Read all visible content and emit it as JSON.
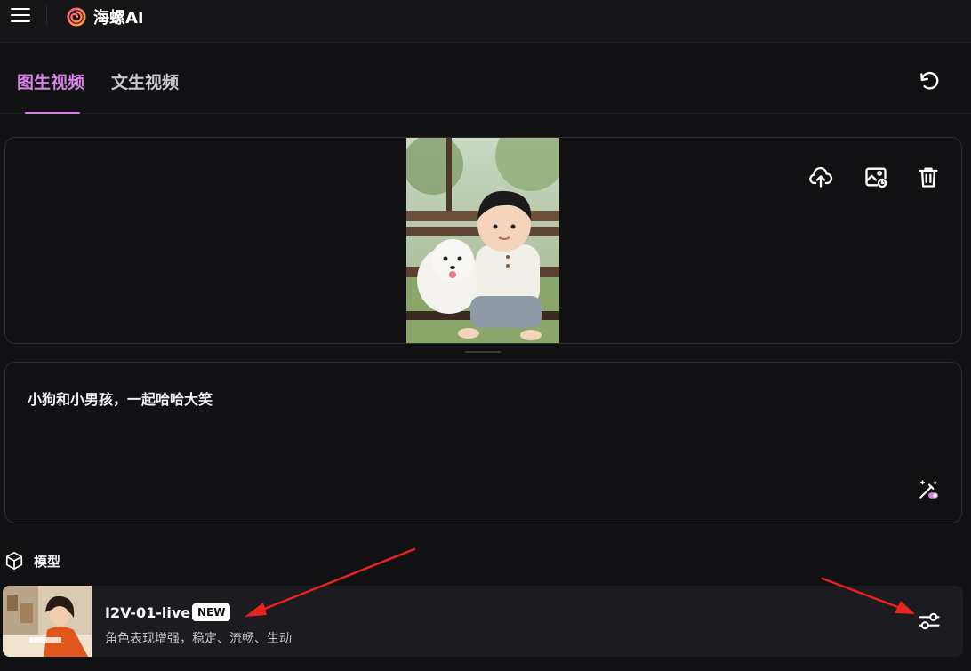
{
  "app": {
    "name": "海螺AI",
    "menu_icon": "hamburger-menu-icon",
    "logo_icon": "hailuo-spiral-logo-icon"
  },
  "tabs": [
    {
      "label": "图生视频",
      "active": true
    },
    {
      "label": "文生视频",
      "active": false
    }
  ],
  "toolbar": {
    "reset_icon": "refresh-icon"
  },
  "image_panel": {
    "image_alt": "boy-and-white-dog-on-bench-photo",
    "tools": [
      "upload-icon",
      "image-history-icon",
      "trash-icon"
    ]
  },
  "prompt": {
    "text": "小狗和小男孩，一起哈哈大笑",
    "magic_icon": "magic-wand-icon"
  },
  "model_section": {
    "label": "模型",
    "icon": "cube-icon",
    "selected": {
      "name": "I2V-01-live",
      "badge": "NEW",
      "description": "角色表现增强，稳定、流畅、生动",
      "settings_icon": "sliders-settings-icon"
    }
  },
  "colors": {
    "accent": "#d584e6",
    "background": "#111114",
    "card": "#1c1c20",
    "border": "#2c2c31",
    "annotation_arrow": "#e8231f"
  }
}
